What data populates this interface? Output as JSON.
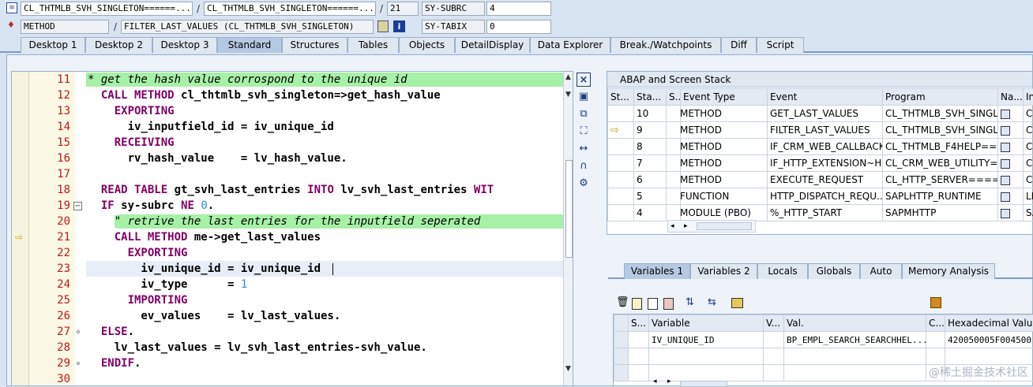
{
  "header": {
    "row1": {
      "class_field": "CL_THTMLB_SVH_SINGLETON======...",
      "sep1": "/",
      "class_field2": "CL_THTMLB_SVH_SINGLETON======...",
      "sep2": "/",
      "line_no": "21",
      "sysvar_name": "SY-SUBRC",
      "sysvar_value": "4"
    },
    "row2": {
      "event_type": "METHOD",
      "sep": "/",
      "method_name": "FILTER_LAST_VALUES (CL_THTMLB_SVH_SINGLETON)",
      "sysvar_name": "SY-TABIX",
      "sysvar_value": "0"
    }
  },
  "tabs": [
    "Desktop 1",
    "Desktop 2",
    "Desktop 3",
    "Standard",
    "Structures",
    "Tables",
    "Objects",
    "DetailDisplay",
    "Data Explorer",
    "Break./Watchpoints",
    "Diff",
    "Script"
  ],
  "active_tab": "Standard",
  "code": {
    "lines": [
      {
        "n": "11",
        "parts": [
          [
            "cmt",
            "* get the hash value corrospond to the unique id"
          ]
        ]
      },
      {
        "n": "12",
        "parts": [
          [
            "kw",
            "  CALL METHOD "
          ],
          [
            "",
            "cl_thtmlb_svh_singleton=>get_hash_value"
          ]
        ]
      },
      {
        "n": "13",
        "parts": [
          [
            "kw",
            "    EXPORTING"
          ]
        ]
      },
      {
        "n": "14",
        "parts": [
          [
            "",
            "      iv_inputfield_id = iv_unique_id"
          ]
        ]
      },
      {
        "n": "15",
        "parts": [
          [
            "kw",
            "    RECEIVING"
          ]
        ]
      },
      {
        "n": "16",
        "parts": [
          [
            "",
            "      rv_hash_value    = lv_hash_value."
          ]
        ]
      },
      {
        "n": "17",
        "parts": []
      },
      {
        "n": "18",
        "parts": [
          [
            "kw",
            "  READ TABLE "
          ],
          [
            "",
            "gt_svh_last_entries "
          ],
          [
            "kw",
            "INTO "
          ],
          [
            "",
            "lv_svh_last_entries "
          ],
          [
            "kw",
            "WIT"
          ]
        ]
      },
      {
        "n": "19",
        "parts": [
          [
            "kw",
            "  IF "
          ],
          [
            "",
            "sy-subrc "
          ],
          [
            "kw",
            "NE "
          ],
          [
            "num",
            "0"
          ],
          [
            "",
            "."
          ]
        ]
      },
      {
        "n": "20",
        "parts": [
          [
            "",
            "    "
          ],
          [
            "cmt",
            "\" retrive the last entries for the inputfield seperated"
          ]
        ]
      },
      {
        "n": "21",
        "parts": [
          [
            "kw",
            "    CALL METHOD "
          ],
          [
            "",
            "me->get_last_values"
          ]
        ]
      },
      {
        "n": "22",
        "parts": [
          [
            "kw",
            "      EXPORTING"
          ]
        ]
      },
      {
        "n": "23",
        "parts": [
          [
            "",
            "        iv_unique_id = iv_unique_id"
          ]
        ]
      },
      {
        "n": "24",
        "parts": [
          [
            "",
            "        iv_type      = "
          ],
          [
            "num",
            "1"
          ]
        ]
      },
      {
        "n": "25",
        "parts": [
          [
            "kw",
            "      IMPORTING"
          ]
        ]
      },
      {
        "n": "26",
        "parts": [
          [
            "",
            "        ev_values    = lv_last_values."
          ]
        ]
      },
      {
        "n": "27",
        "parts": [
          [
            "kw",
            "  ELSE"
          ],
          [
            "",
            "."
          ]
        ]
      },
      {
        "n": "28",
        "parts": [
          [
            "",
            "    lv_last_values = lv_svh_last_entries-svh_value."
          ]
        ]
      },
      {
        "n": "29",
        "parts": [
          [
            "kw",
            "  ENDIF"
          ],
          [
            "",
            "."
          ]
        ]
      },
      {
        "n": "30",
        "parts": []
      }
    ]
  },
  "stack_panel": {
    "title": "ABAP and Screen Stack",
    "columns": [
      "St...",
      "Sta...",
      "S...",
      "Event Type",
      "Event",
      "Program",
      "Na...",
      "In"
    ],
    "rows": [
      {
        "marker": "",
        "level": "10",
        "type": "METHOD",
        "event": "GET_LAST_VALUES",
        "program": "CL_THTMLB_SVH_SINGL...",
        "inc": "CL"
      },
      {
        "marker": "arrow",
        "level": "9",
        "type": "METHOD",
        "event": "FILTER_LAST_VALUES",
        "program": "CL_THTMLB_SVH_SINGL...",
        "inc": "CL"
      },
      {
        "marker": "",
        "level": "8",
        "type": "METHOD",
        "event": "IF_CRM_WEB_CALLBACK...",
        "program": "CL_THTMLB_F4HELP==...",
        "inc": "CL"
      },
      {
        "marker": "",
        "level": "7",
        "type": "METHOD",
        "event": "IF_HTTP_EXTENSION~H...",
        "program": "CL_CRM_WEB_UTILITY=...",
        "inc": "CL"
      },
      {
        "marker": "",
        "level": "6",
        "type": "METHOD",
        "event": "EXECUTE_REQUEST",
        "program": "CL_HTTP_SERVER====...",
        "inc": "CL"
      },
      {
        "marker": "",
        "level": "5",
        "type": "FUNCTION",
        "event": "HTTP_DISPATCH_REQU...",
        "program": "SAPLHTTP_RUNTIME",
        "inc": "LH"
      },
      {
        "marker": "",
        "level": "4",
        "type": "MODULE (PBO)",
        "event": "%_HTTP_START",
        "program": "SAPMHTTP",
        "inc": "SA"
      }
    ]
  },
  "var_tabs": [
    "Variables 1",
    "Variables 2",
    "Locals",
    "Globals",
    "Auto",
    "Memory Analysis"
  ],
  "var_active": "Variables 1",
  "var_table": {
    "columns": [
      "S...",
      "Variable",
      "V...",
      "Val.",
      "C...",
      "Hexadecimal Value"
    ],
    "rows": [
      {
        "variable": "IV_UNIQUE_ID",
        "value": "BP_EMPL_SEARCH_SEARCHHEL...",
        "hex": "420050005F004500"
      }
    ]
  },
  "watermark": "@稀土掘金技术社区"
}
